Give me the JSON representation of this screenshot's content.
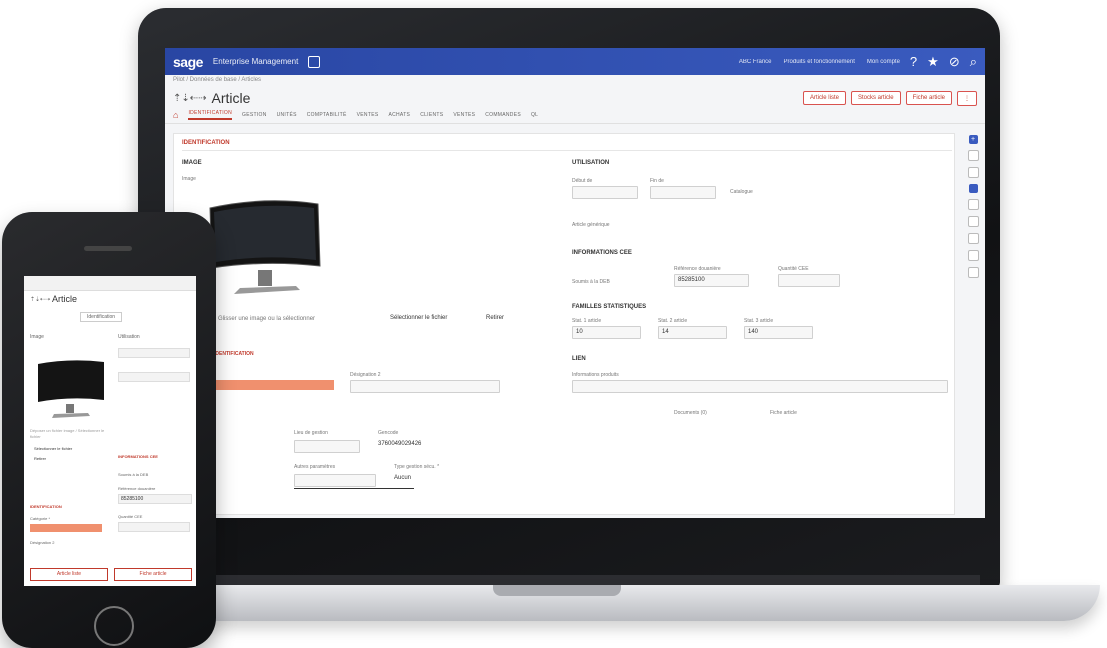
{
  "laptop": {
    "topbar": {
      "logo": "sage",
      "app_name": "Enterprise Management",
      "items": [
        "ABC France",
        "Produits et fonctionnement",
        "Mon compte"
      ],
      "help_glyph": "?",
      "star_glyph": "★",
      "compass_glyph": "⊘",
      "search_glyph": "⌕"
    },
    "breadcrumb": "Pilot / Données de base / Articles",
    "title": "Article",
    "title_arrows": "⇡⇣⇠⇢",
    "actions": [
      "Article liste",
      "Stocks article",
      "Fiche article"
    ],
    "tabs": [
      "Identification",
      "Gestion",
      "Unités",
      "Comptabilité",
      "Ventes",
      "Achats",
      "Clients",
      "Ventes",
      "Commandes",
      "QL"
    ],
    "section_title": "IDENTIFICATION",
    "image_block": {
      "title": "IMAGE",
      "sub": "Image",
      "upload_hint": "Glisser une image ou la sélectionner",
      "select_file": "Sélectionner le fichier",
      "remove": "Retirer"
    },
    "utilisation": {
      "title": "UTILISATION",
      "start_label": "Début de",
      "end_label": "Fin de",
      "check_label": "Catalogue",
      "check2_label": "Article générique"
    },
    "informations": {
      "title": "INFORMATIONS CEE",
      "checkbox_label": "Soumis à la DEB",
      "ref_label": "Référence douanière",
      "ref_value": "85285100",
      "qty_label": "Quantité CEE"
    },
    "familles": {
      "title": "FAMILLES STATISTIQUES",
      "cols": [
        {
          "label": "Stat. 1 article",
          "value": "10"
        },
        {
          "label": "Stat. 2 article",
          "value": "14"
        },
        {
          "label": "Stat. 3 article",
          "value": "140"
        }
      ]
    },
    "lien": {
      "title": "LIEN",
      "label": "Informations produits"
    },
    "bottom_links": [
      "Documents (0)",
      "Fiche article"
    ],
    "identification": {
      "title": "IDENTIFICATION",
      "designation_label": "Désignation 2",
      "lieu_label": "Lieu de gestion",
      "lieu_value": "",
      "gencod_label": "Gencode",
      "gencod_value": "3760049029426",
      "autres_label": "Autres paramètres",
      "cycle_label": "Type gestion sécu. *",
      "cycle_value": "Aucun"
    }
  },
  "phone": {
    "title": "Article",
    "title_arrows": "⇡⇣⇠⇢",
    "tab": "Identification",
    "image_label": "Image",
    "utilisation_label": "Utilisation",
    "upload_hint": "Déposer un fichier image / Sélectionner le fichier",
    "select_file": "Sélectionner le fichier",
    "remove": "Retirer",
    "info_title": "INFORMATIONS CEE",
    "checkbox_label": "Soumis à la DEB",
    "ref_label": "Référence douanière",
    "ref_value": "85285100",
    "qty_label": "Quantité CEE",
    "ident_title": "IDENTIFICATION",
    "cat_label": "Catégorie *",
    "des_label": "Désignation 2",
    "btn_left": "Article liste",
    "btn_right": "Fiche article"
  }
}
